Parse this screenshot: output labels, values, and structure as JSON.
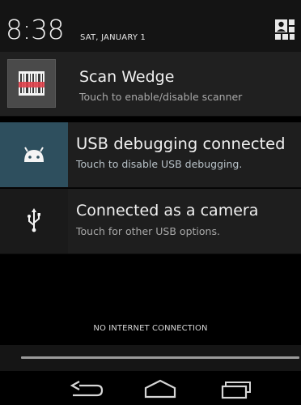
{
  "header": {
    "time": "8:38",
    "date": "SAT, JANUARY 1"
  },
  "notifications": [
    {
      "title": "Scan Wedge",
      "subtitle": "Touch to enable/disable scanner",
      "icon": "barcode-icon"
    },
    {
      "title": "USB debugging connected",
      "subtitle": "Touch to disable USB debugging.",
      "icon": "android-icon"
    },
    {
      "title": "Connected as a camera",
      "subtitle": "Touch for other USB options.",
      "icon": "usb-icon"
    }
  ],
  "status": {
    "text": "NO INTERNET CONNECTION"
  },
  "colors": {
    "accent_usb": "#2e4f5e",
    "barcode_red": "#e0404a"
  },
  "navbar": {
    "icons": [
      "back-icon",
      "home-icon",
      "recent-apps-icon"
    ]
  }
}
